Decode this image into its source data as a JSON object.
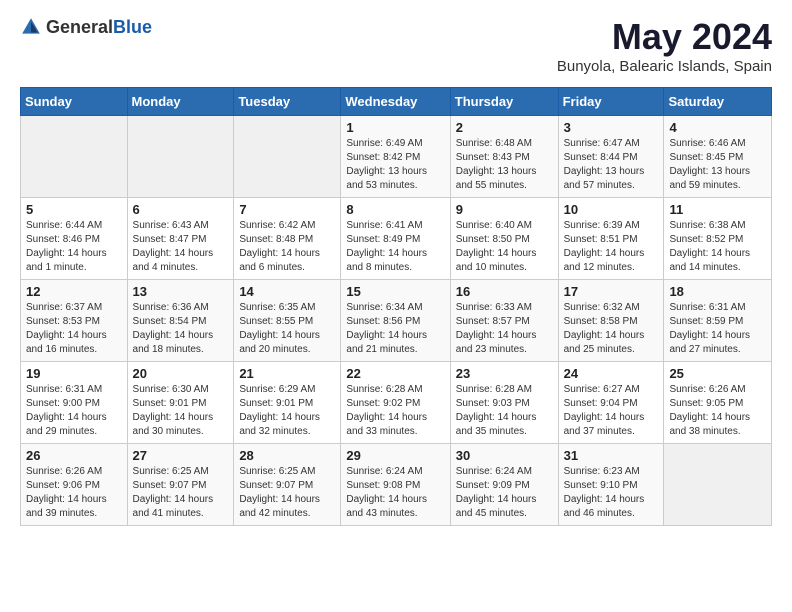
{
  "header": {
    "logo_general": "General",
    "logo_blue": "Blue",
    "month_title": "May 2024",
    "location": "Bunyola, Balearic Islands, Spain"
  },
  "calendar": {
    "weekdays": [
      "Sunday",
      "Monday",
      "Tuesday",
      "Wednesday",
      "Thursday",
      "Friday",
      "Saturday"
    ],
    "weeks": [
      [
        {
          "day": "",
          "info": ""
        },
        {
          "day": "",
          "info": ""
        },
        {
          "day": "",
          "info": ""
        },
        {
          "day": "1",
          "info": "Sunrise: 6:49 AM\nSunset: 8:42 PM\nDaylight: 13 hours and 53 minutes."
        },
        {
          "day": "2",
          "info": "Sunrise: 6:48 AM\nSunset: 8:43 PM\nDaylight: 13 hours and 55 minutes."
        },
        {
          "day": "3",
          "info": "Sunrise: 6:47 AM\nSunset: 8:44 PM\nDaylight: 13 hours and 57 minutes."
        },
        {
          "day": "4",
          "info": "Sunrise: 6:46 AM\nSunset: 8:45 PM\nDaylight: 13 hours and 59 minutes."
        }
      ],
      [
        {
          "day": "5",
          "info": "Sunrise: 6:44 AM\nSunset: 8:46 PM\nDaylight: 14 hours and 1 minute."
        },
        {
          "day": "6",
          "info": "Sunrise: 6:43 AM\nSunset: 8:47 PM\nDaylight: 14 hours and 4 minutes."
        },
        {
          "day": "7",
          "info": "Sunrise: 6:42 AM\nSunset: 8:48 PM\nDaylight: 14 hours and 6 minutes."
        },
        {
          "day": "8",
          "info": "Sunrise: 6:41 AM\nSunset: 8:49 PM\nDaylight: 14 hours and 8 minutes."
        },
        {
          "day": "9",
          "info": "Sunrise: 6:40 AM\nSunset: 8:50 PM\nDaylight: 14 hours and 10 minutes."
        },
        {
          "day": "10",
          "info": "Sunrise: 6:39 AM\nSunset: 8:51 PM\nDaylight: 14 hours and 12 minutes."
        },
        {
          "day": "11",
          "info": "Sunrise: 6:38 AM\nSunset: 8:52 PM\nDaylight: 14 hours and 14 minutes."
        }
      ],
      [
        {
          "day": "12",
          "info": "Sunrise: 6:37 AM\nSunset: 8:53 PM\nDaylight: 14 hours and 16 minutes."
        },
        {
          "day": "13",
          "info": "Sunrise: 6:36 AM\nSunset: 8:54 PM\nDaylight: 14 hours and 18 minutes."
        },
        {
          "day": "14",
          "info": "Sunrise: 6:35 AM\nSunset: 8:55 PM\nDaylight: 14 hours and 20 minutes."
        },
        {
          "day": "15",
          "info": "Sunrise: 6:34 AM\nSunset: 8:56 PM\nDaylight: 14 hours and 21 minutes."
        },
        {
          "day": "16",
          "info": "Sunrise: 6:33 AM\nSunset: 8:57 PM\nDaylight: 14 hours and 23 minutes."
        },
        {
          "day": "17",
          "info": "Sunrise: 6:32 AM\nSunset: 8:58 PM\nDaylight: 14 hours and 25 minutes."
        },
        {
          "day": "18",
          "info": "Sunrise: 6:31 AM\nSunset: 8:59 PM\nDaylight: 14 hours and 27 minutes."
        }
      ],
      [
        {
          "day": "19",
          "info": "Sunrise: 6:31 AM\nSunset: 9:00 PM\nDaylight: 14 hours and 29 minutes."
        },
        {
          "day": "20",
          "info": "Sunrise: 6:30 AM\nSunset: 9:01 PM\nDaylight: 14 hours and 30 minutes."
        },
        {
          "day": "21",
          "info": "Sunrise: 6:29 AM\nSunset: 9:01 PM\nDaylight: 14 hours and 32 minutes."
        },
        {
          "day": "22",
          "info": "Sunrise: 6:28 AM\nSunset: 9:02 PM\nDaylight: 14 hours and 33 minutes."
        },
        {
          "day": "23",
          "info": "Sunrise: 6:28 AM\nSunset: 9:03 PM\nDaylight: 14 hours and 35 minutes."
        },
        {
          "day": "24",
          "info": "Sunrise: 6:27 AM\nSunset: 9:04 PM\nDaylight: 14 hours and 37 minutes."
        },
        {
          "day": "25",
          "info": "Sunrise: 6:26 AM\nSunset: 9:05 PM\nDaylight: 14 hours and 38 minutes."
        }
      ],
      [
        {
          "day": "26",
          "info": "Sunrise: 6:26 AM\nSunset: 9:06 PM\nDaylight: 14 hours and 39 minutes."
        },
        {
          "day": "27",
          "info": "Sunrise: 6:25 AM\nSunset: 9:07 PM\nDaylight: 14 hours and 41 minutes."
        },
        {
          "day": "28",
          "info": "Sunrise: 6:25 AM\nSunset: 9:07 PM\nDaylight: 14 hours and 42 minutes."
        },
        {
          "day": "29",
          "info": "Sunrise: 6:24 AM\nSunset: 9:08 PM\nDaylight: 14 hours and 43 minutes."
        },
        {
          "day": "30",
          "info": "Sunrise: 6:24 AM\nSunset: 9:09 PM\nDaylight: 14 hours and 45 minutes."
        },
        {
          "day": "31",
          "info": "Sunrise: 6:23 AM\nSunset: 9:10 PM\nDaylight: 14 hours and 46 minutes."
        },
        {
          "day": "",
          "info": ""
        }
      ]
    ]
  }
}
